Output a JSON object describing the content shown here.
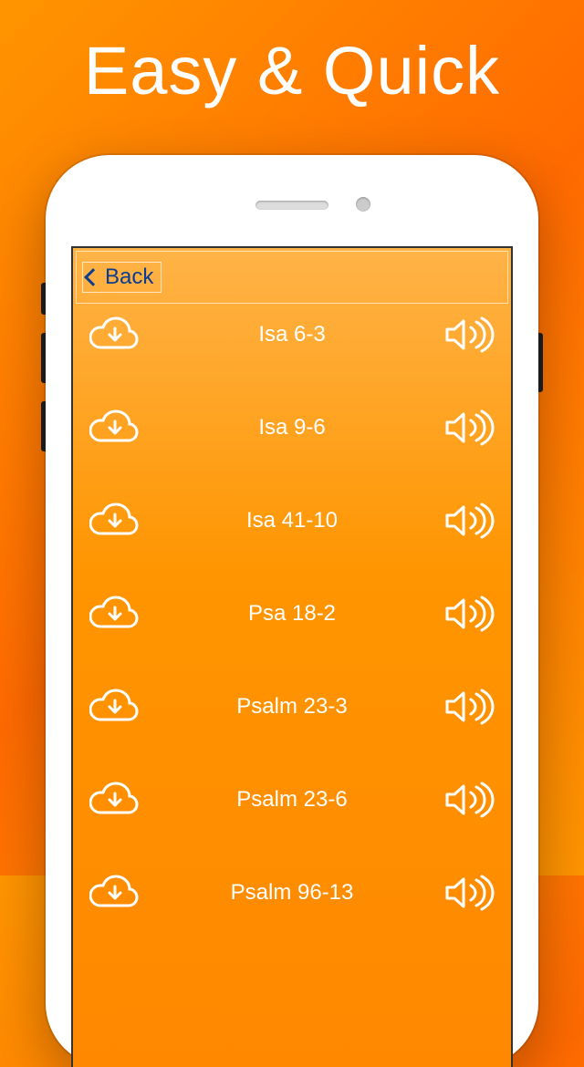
{
  "headline": "Easy & Quick",
  "nav": {
    "back_label": "Back"
  },
  "list": {
    "items": [
      {
        "title": "Isa 6-3"
      },
      {
        "title": "Isa 9-6"
      },
      {
        "title": "Isa 41-10"
      },
      {
        "title": "Psa 18-2"
      },
      {
        "title": "Psalm 23-3"
      },
      {
        "title": "Psalm 23-6"
      },
      {
        "title": "Psalm 96-13"
      }
    ]
  },
  "icons": {
    "download": "cloud-download-icon",
    "play": "speaker-icon"
  }
}
